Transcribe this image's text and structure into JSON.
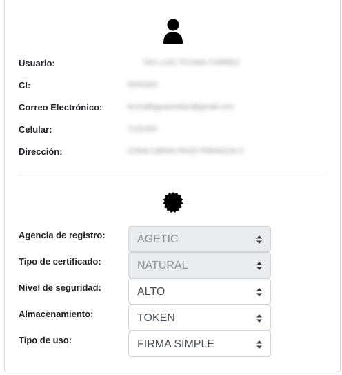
{
  "profile": {
    "icon": "user-icon",
    "fields": [
      {
        "label": "Usuario:",
        "value": "TAS LUIS TICONA TORREZ"
      },
      {
        "label": "CI:",
        "value": "9004300"
      },
      {
        "label": "Correo Electrónico:",
        "value": "ticonalfaguarantian@gmail.com"
      },
      {
        "label": "Celular:",
        "value": "7131333"
      },
      {
        "label": "Dirección:",
        "value": "ZONA LIMANI PASO PARAGUA 4"
      }
    ]
  },
  "certificate": {
    "icon": "seal-icon",
    "fields": [
      {
        "label": "Agencia de registro:",
        "value": "AGETIC",
        "disabled": true
      },
      {
        "label": "Tipo de certificado:",
        "value": "NATURAL",
        "disabled": true
      },
      {
        "label": "Nivel de seguridad:",
        "value": "ALTO",
        "disabled": false
      },
      {
        "label": "Almacenamiento:",
        "value": "TOKEN",
        "disabled": false
      },
      {
        "label": "Tipo de uso:",
        "value": "FIRMA SIMPLE",
        "disabled": false
      }
    ]
  }
}
